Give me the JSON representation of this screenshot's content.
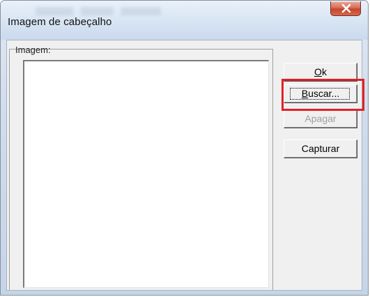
{
  "window": {
    "title": "Imagem de cabeçalho"
  },
  "titlebar": {
    "close_icon": "close-x-icon",
    "close_color": "#c5452c"
  },
  "group": {
    "label": "Imagem:"
  },
  "buttons": {
    "ok": {
      "accel": "O",
      "rest": "k",
      "enabled": true
    },
    "buscar": {
      "accel": "B",
      "rest": "uscar...",
      "enabled": true,
      "focused": true
    },
    "apagar": {
      "label": "Apagar",
      "enabled": false
    },
    "capturar": {
      "label": "Capturar",
      "enabled": true
    }
  },
  "annotation": {
    "highlight_color": "#e12027",
    "highlight_target": "buscar"
  }
}
